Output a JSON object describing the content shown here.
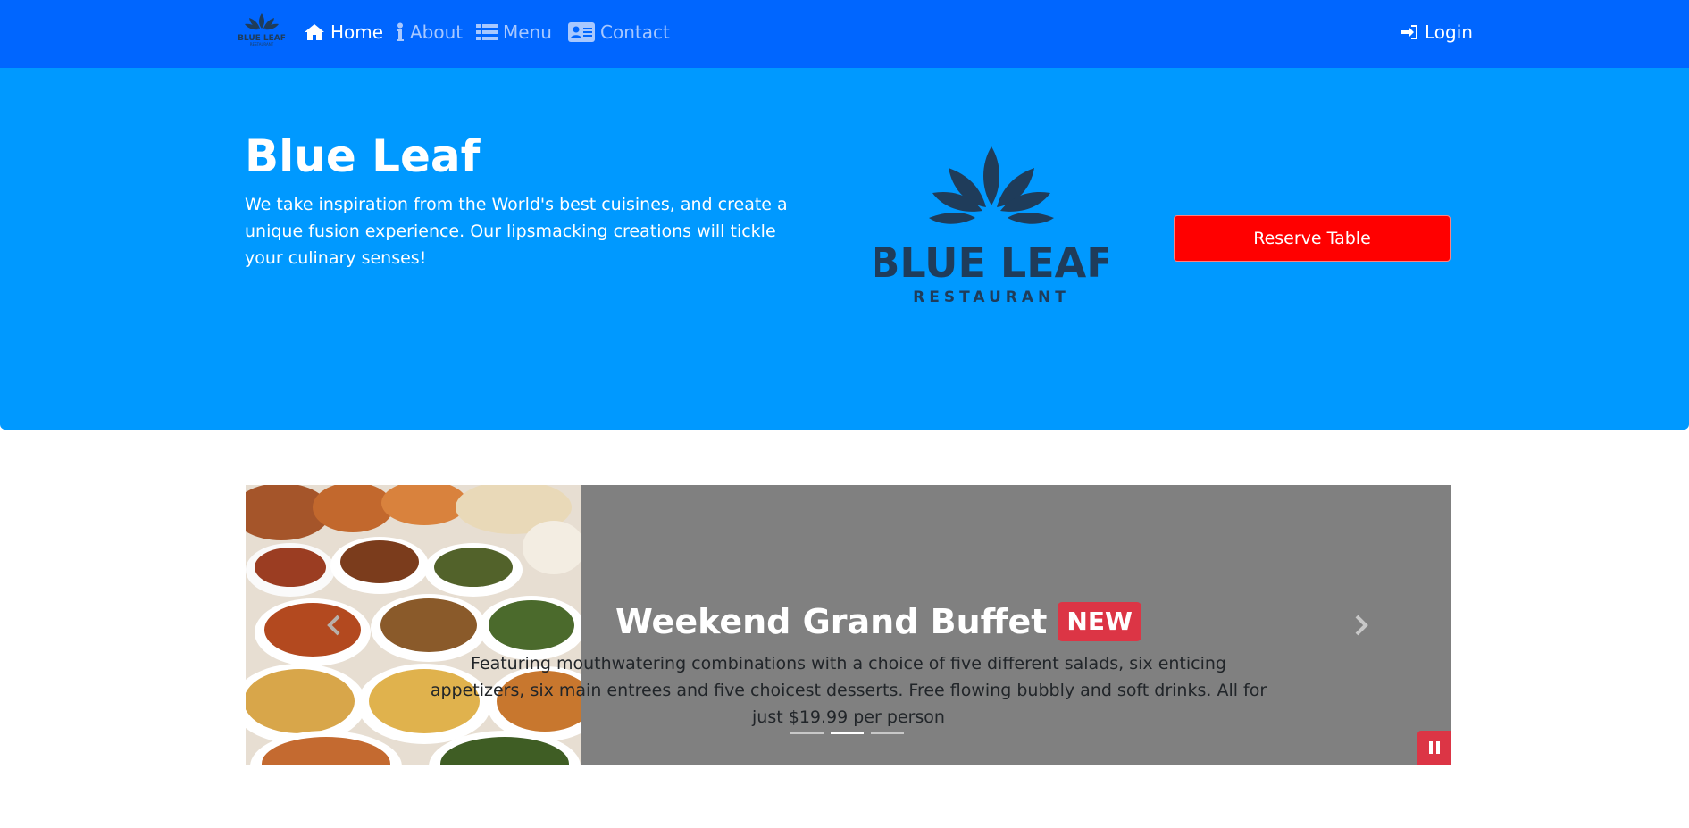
{
  "navbar": {
    "brand_logo": {
      "icon": "blue-leaf-logo-icon",
      "text": "BLUE LEAF",
      "subtext": "RESTAURANT"
    },
    "items": [
      {
        "label": "Home",
        "icon": "home-icon",
        "active": true
      },
      {
        "label": "About",
        "icon": "info-icon",
        "active": false
      },
      {
        "label": "Menu",
        "icon": "list-icon",
        "active": false
      },
      {
        "label": "Contact",
        "icon": "address-card-icon",
        "active": false
      }
    ],
    "login": {
      "label": "Login",
      "icon": "sign-in-icon"
    }
  },
  "hero": {
    "title": "Blue Leaf",
    "text": "We take inspiration from the World's best cuisines, and create a unique fusion experience. Our lipsmacking creations will tickle your culinary senses!",
    "logo": {
      "title": "BLUE LEAF",
      "subtitle": "RESTAURANT"
    },
    "reserve_label": "Reserve Table"
  },
  "carousel": {
    "title": "Weekend Grand Buffet",
    "badge": "NEW",
    "text": "Featuring mouthwatering combinations with a choice of five different salads, six enticing appetizers, six main entrees and five choicest desserts. Free flowing bubbly and soft drinks. All for just $19.99 per person",
    "indicators": 3,
    "active_indicator": 1
  },
  "colors": {
    "navbar": "#0066ff",
    "jumbotron": "#0099ff",
    "reserve_button": "#ff0000",
    "badge": "#dc3545",
    "carousel_bg": "#808080",
    "logo": "#1f3c5a"
  }
}
